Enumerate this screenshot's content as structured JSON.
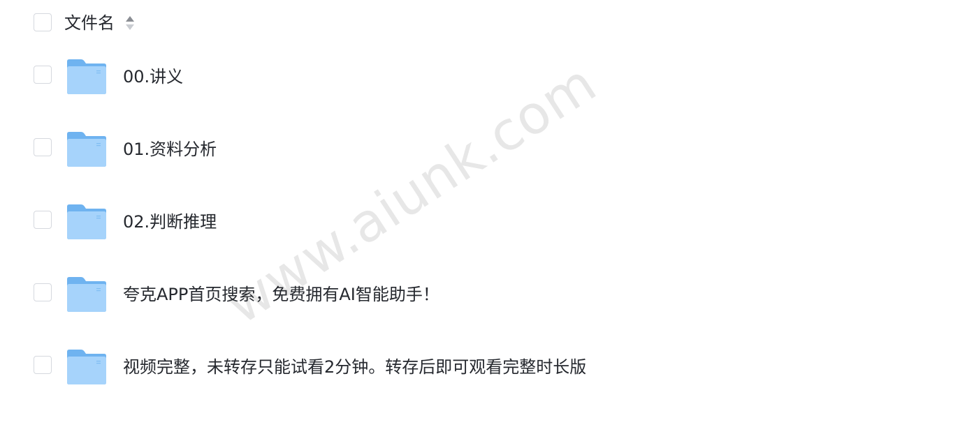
{
  "header": {
    "column_label": "文件名",
    "sort_icon": "sort-icon"
  },
  "files": [
    {
      "name": "00.讲义",
      "icon": "folder-icon"
    },
    {
      "name": "01.资料分析",
      "icon": "folder-icon"
    },
    {
      "name": "02.判断推理",
      "icon": "folder-icon"
    },
    {
      "name": "夸克APP首页搜索，免费拥有AI智能助手！",
      "icon": "folder-icon"
    },
    {
      "name": "视频完整，未转存只能试看2分钟。转存后即可观看完整时长版",
      "icon": "folder-icon"
    }
  ],
  "watermark": "www.aiunk.com",
  "colors": {
    "text": "#25282e",
    "checkbox_border": "#d5d8de",
    "folder_back": "#6fb3f0",
    "folder_front": "#a6d3fb",
    "sort_active": "#8a8d93",
    "sort_inactive": "#c9ccd1"
  }
}
